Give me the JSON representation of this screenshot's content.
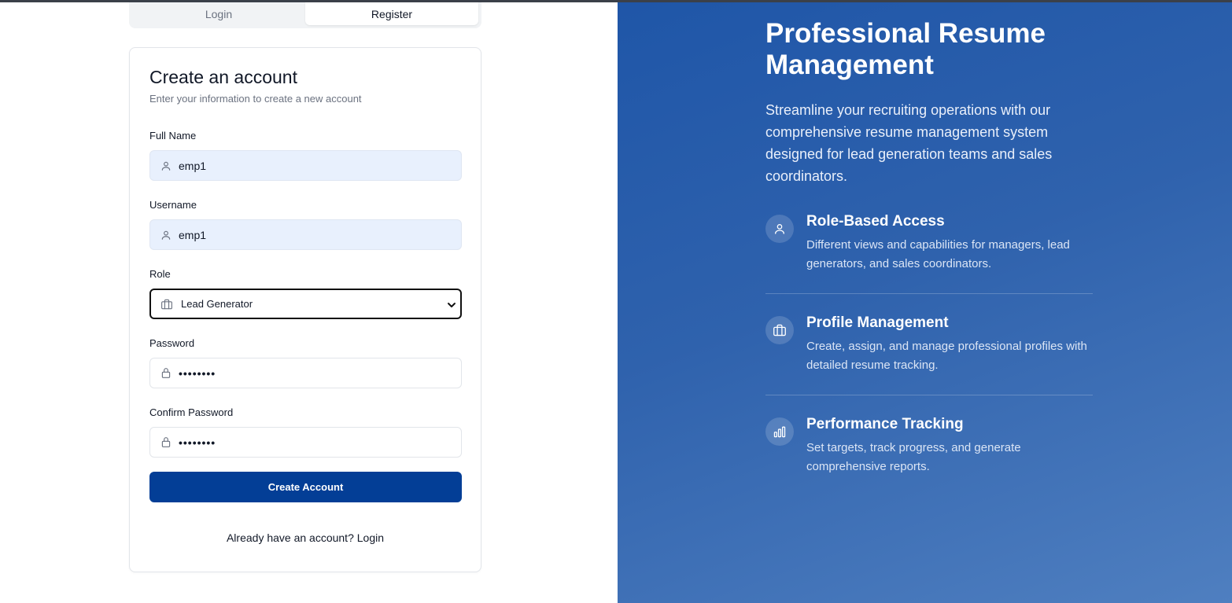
{
  "tabs": [
    {
      "label": "Login",
      "active": false
    },
    {
      "label": "Register",
      "active": true
    }
  ],
  "form": {
    "title": "Create an account",
    "subtitle": "Enter your information to create a new account",
    "full_name": {
      "label": "Full Name",
      "value": "emp1",
      "icon": "user-icon"
    },
    "username": {
      "label": "Username",
      "value": "emp1",
      "icon": "user-icon"
    },
    "role": {
      "label": "Role",
      "value": "Lead Generator",
      "icon": "briefcase-icon"
    },
    "password": {
      "label": "Password",
      "value": "••••••••",
      "icon": "lock-icon"
    },
    "confirm_password": {
      "label": "Confirm Password",
      "value": "••••••••",
      "icon": "lock-icon"
    },
    "submit_label": "Create Account",
    "switch_prompt": "Already have an account? Login"
  },
  "hero": {
    "title": "Professional Resume Management",
    "description": "Streamline your recruiting operations with our comprehensive resume management system designed for lead generation teams and sales coordinators.",
    "features": [
      {
        "icon": "user-icon",
        "title": "Role-Based Access",
        "description": "Different views and capabilities for managers, lead generators, and sales coordinators."
      },
      {
        "icon": "briefcase-icon",
        "title": "Profile Management",
        "description": "Create, assign, and manage professional profiles with detailed resume tracking."
      },
      {
        "icon": "bar-chart-icon",
        "title": "Performance Tracking",
        "description": "Set targets, track progress, and generate comprehensive reports."
      }
    ]
  },
  "colors": {
    "primary_button": "#033e96",
    "hero_gradient_start": "#1f56a8",
    "hero_gradient_end": "#4f7fc0",
    "filled_input": "#e8f0fd"
  }
}
